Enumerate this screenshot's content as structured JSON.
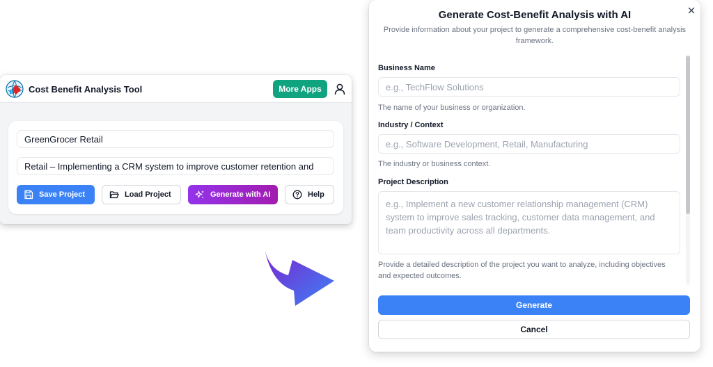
{
  "app": {
    "title": "Cost Benefit Analysis Tool",
    "more_apps_label": "More Apps",
    "business_value": "GreenGrocer Retail",
    "description_value": "Retail – Implementing a CRM system to improve customer retention and",
    "buttons": {
      "save": "Save Project",
      "load": "Load Project",
      "generate": "Generate with AI",
      "help": "Help"
    },
    "icons": {
      "logo": "globe-chart-logo",
      "user": "user-icon",
      "save": "floppy-disk-icon",
      "load": "folder-open-icon",
      "generate": "sparkles-icon",
      "help": "question-circle-icon"
    }
  },
  "modal": {
    "title": "Generate Cost-Benefit Analysis with AI",
    "subtitle": "Provide information about your project to generate a comprehensive cost-benefit analysis framework.",
    "fields": {
      "business_name": {
        "label": "Business Name",
        "placeholder": "e.g., TechFlow Solutions",
        "hint": "The name of your business or organization."
      },
      "industry": {
        "label": "Industry / Context",
        "placeholder": "e.g., Software Development, Retail, Manufacturing",
        "hint": "The industry or business context."
      },
      "project_description": {
        "label": "Project Description",
        "placeholder": "e.g., Implement a new customer relationship management (CRM) system to improve sales tracking, customer data management, and team productivity across all departments.",
        "hint": "Provide a detailed description of the project you want to analyze, including objectives and expected outcomes."
      }
    },
    "generate_label": "Generate",
    "cancel_label": "Cancel"
  },
  "colors": {
    "more_apps": "#10a37f",
    "primary_blue": "#3b82f6",
    "ai_purple": "#9333ea",
    "arrow_start": "#7e22ce",
    "arrow_end": "#3b82f6"
  }
}
